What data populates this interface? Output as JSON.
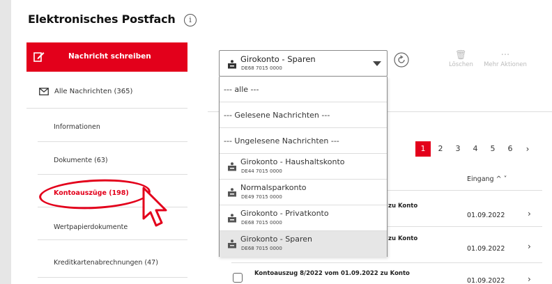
{
  "header": {
    "title": "Elektronisches Postfach",
    "info_icon": "info-icon"
  },
  "sidebar": {
    "compose_label": "Nachricht schreiben",
    "all_messages": "Alle Nachrichten (365)",
    "items": [
      {
        "label": "Informationen"
      },
      {
        "label": "Dokumente (63)"
      },
      {
        "label": "Kontoauszüge (198)",
        "active": true
      },
      {
        "label": "Wertpapierdokumente"
      },
      {
        "label": "Kreditkartenabrechnungen (47)"
      }
    ]
  },
  "account_select": {
    "selected_name": "Girokonto - Sparen",
    "selected_iban": "DE68 7015 0000",
    "options": [
      {
        "label": "--- alle ---"
      },
      {
        "label": "--- Gelesene Nachrichten ---"
      },
      {
        "label": "--- Ungelesene Nachrichten ---"
      },
      {
        "name": "Girokonto - Haushaltskonto",
        "iban": "DE44 7015 0000"
      },
      {
        "name": "Normalsparkonto",
        "iban": "DE49 7015 0000"
      },
      {
        "name": "Girokonto - Privatkonto",
        "iban": "DE68 7015 0000"
      },
      {
        "name": "Girokonto - Sparen",
        "iban": "DE68 7015 0000",
        "selected": true
      }
    ]
  },
  "toolbar": {
    "delete_label": "Löschen",
    "more_label": "Mehr Aktionen"
  },
  "pagination": {
    "pages": [
      "1",
      "2",
      "3",
      "4",
      "5",
      "6"
    ],
    "current": "1",
    "next": "›"
  },
  "list": {
    "sort_label": "Eingang ^ ˅",
    "rows": [
      {
        "title_fragment": "zu Konto",
        "date": "01.09.2022"
      },
      {
        "title_fragment": "zu Konto",
        "date": "01.09.2022"
      },
      {
        "title": "Kontoauszug 8/2022 vom 01.09.2022 zu Konto",
        "date": "01.09.2022"
      }
    ]
  },
  "colors": {
    "brand_red": "#e3001b",
    "selected_option_bg": "#e6e6e6"
  }
}
